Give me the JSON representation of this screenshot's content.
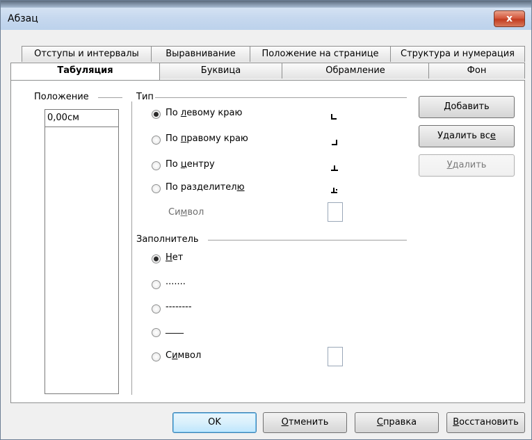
{
  "window": {
    "title": "Абзац",
    "close_label": "x"
  },
  "tabs_row1": [
    {
      "label": "Отступы и интервалы"
    },
    {
      "label": "Выравнивание"
    },
    {
      "label": "Положение на странице"
    },
    {
      "label": "Структура и нумерация"
    }
  ],
  "tabs_row2": [
    {
      "label": "Табуляция",
      "active": true
    },
    {
      "label": "Буквица"
    },
    {
      "label": "Обрамление"
    },
    {
      "label": "Фон"
    }
  ],
  "position": {
    "label": "Положение",
    "value": "0,00см"
  },
  "type": {
    "label": "Тип",
    "options": [
      {
        "label": "По левому краю",
        "selected": true,
        "icon": "tab-left-icon"
      },
      {
        "label": "По правому краю",
        "selected": false,
        "icon": "tab-right-icon"
      },
      {
        "label": "По центру",
        "selected": false,
        "icon": "tab-center-icon"
      },
      {
        "label": "По разделителю",
        "selected": false,
        "icon": "tab-decimal-icon"
      }
    ],
    "symbol_label": "Символ"
  },
  "fill": {
    "label": "Заполнитель",
    "options": [
      {
        "label": "Нет",
        "selected": true
      },
      {
        "label": ".......",
        "selected": false
      },
      {
        "label": "--------",
        "selected": false
      },
      {
        "label": "____",
        "selected": false
      },
      {
        "label": "Символ",
        "selected": false
      }
    ]
  },
  "side_buttons": {
    "add": "Добавить",
    "delete_all": "Удалить все",
    "delete": "Удалить"
  },
  "footer_buttons": {
    "ok": "OK",
    "cancel": "Отменить",
    "help": "Справка",
    "reset": "Восстановить"
  }
}
